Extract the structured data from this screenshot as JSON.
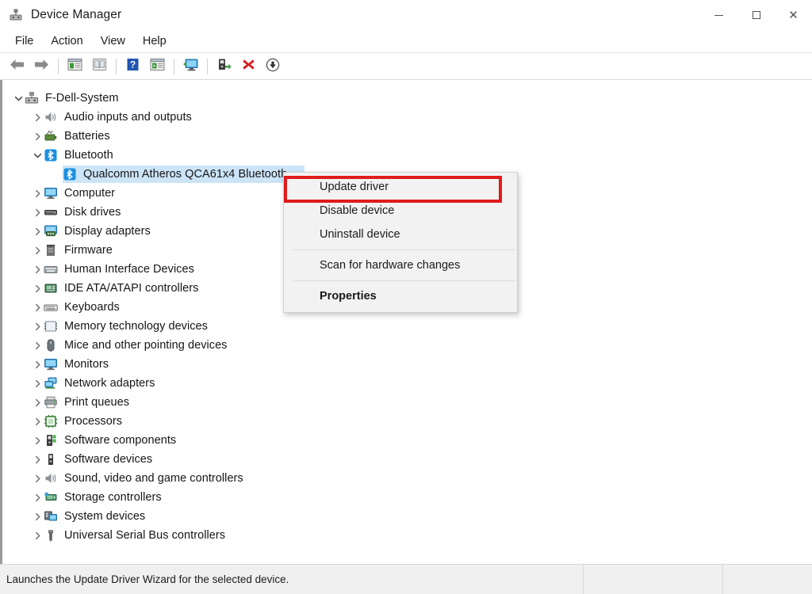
{
  "window": {
    "title": "Device Manager",
    "icon": "device-manager-icon",
    "controls": {
      "minimize": "minimize-icon",
      "maximize": "maximize-icon",
      "close": "close-icon"
    }
  },
  "menubar": {
    "items": [
      {
        "label": "File"
      },
      {
        "label": "Action"
      },
      {
        "label": "View"
      },
      {
        "label": "Help"
      }
    ]
  },
  "toolbar": {
    "buttons": [
      {
        "name": "back-arrow-icon",
        "icon": "arrow-left"
      },
      {
        "name": "forward-arrow-icon",
        "icon": "arrow-right"
      },
      {
        "name": "separator",
        "icon": "sep"
      },
      {
        "name": "properties-icon",
        "icon": "window-props"
      },
      {
        "name": "help-topics-icon",
        "icon": "book"
      },
      {
        "name": "separator",
        "icon": "sep"
      },
      {
        "name": "help-icon",
        "icon": "question"
      },
      {
        "name": "show-hidden-devices-icon",
        "icon": "window-play"
      },
      {
        "name": "separator",
        "icon": "sep"
      },
      {
        "name": "scan-hardware-changes-icon",
        "icon": "monitor-scan"
      },
      {
        "name": "separator",
        "icon": "sep"
      },
      {
        "name": "update-driver-icon",
        "icon": "driver-update"
      },
      {
        "name": "uninstall-device-icon",
        "icon": "red-x"
      },
      {
        "name": "disable-device-icon",
        "icon": "down-arrow-circle"
      }
    ]
  },
  "tree": {
    "nodes": [
      {
        "label": "F-Dell-System",
        "level": 0,
        "expanded": true,
        "icon": "computer-root-icon",
        "selected": false
      },
      {
        "label": "Audio inputs and outputs",
        "level": 1,
        "expanded": false,
        "icon": "speaker-icon",
        "selected": false
      },
      {
        "label": "Batteries",
        "level": 1,
        "expanded": false,
        "icon": "battery-icon",
        "selected": false
      },
      {
        "label": "Bluetooth",
        "level": 1,
        "expanded": true,
        "icon": "bluetooth-icon",
        "selected": false
      },
      {
        "label": "Qualcomm Atheros QCA61x4 Bluetooth",
        "level": 2,
        "expanded": null,
        "icon": "bluetooth-icon",
        "selected": true
      },
      {
        "label": "Computer",
        "level": 1,
        "expanded": false,
        "icon": "monitor-icon",
        "selected": false
      },
      {
        "label": "Disk drives",
        "level": 1,
        "expanded": false,
        "icon": "disk-icon",
        "selected": false
      },
      {
        "label": "Display adapters",
        "level": 1,
        "expanded": false,
        "icon": "display-adapter-icon",
        "selected": false
      },
      {
        "label": "Firmware",
        "level": 1,
        "expanded": false,
        "icon": "firmware-icon",
        "selected": false
      },
      {
        "label": "Human Interface Devices",
        "level": 1,
        "expanded": false,
        "icon": "hid-icon",
        "selected": false
      },
      {
        "label": "IDE ATA/ATAPI controllers",
        "level": 1,
        "expanded": false,
        "icon": "ide-controller-icon",
        "selected": false
      },
      {
        "label": "Keyboards",
        "level": 1,
        "expanded": false,
        "icon": "keyboard-icon",
        "selected": false
      },
      {
        "label": "Memory technology devices",
        "level": 1,
        "expanded": false,
        "icon": "memory-icon",
        "selected": false
      },
      {
        "label": "Mice and other pointing devices",
        "level": 1,
        "expanded": false,
        "icon": "mouse-icon",
        "selected": false
      },
      {
        "label": "Monitors",
        "level": 1,
        "expanded": false,
        "icon": "monitor-icon",
        "selected": false
      },
      {
        "label": "Network adapters",
        "level": 1,
        "expanded": false,
        "icon": "network-adapter-icon",
        "selected": false
      },
      {
        "label": "Print queues",
        "level": 1,
        "expanded": false,
        "icon": "printer-icon",
        "selected": false
      },
      {
        "label": "Processors",
        "level": 1,
        "expanded": false,
        "icon": "processor-icon",
        "selected": false
      },
      {
        "label": "Software components",
        "level": 1,
        "expanded": false,
        "icon": "software-component-icon",
        "selected": false
      },
      {
        "label": "Software devices",
        "level": 1,
        "expanded": false,
        "icon": "software-device-icon",
        "selected": false
      },
      {
        "label": "Sound, video and game controllers",
        "level": 1,
        "expanded": false,
        "icon": "sound-icon",
        "selected": false
      },
      {
        "label": "Storage controllers",
        "level": 1,
        "expanded": false,
        "icon": "storage-controller-icon",
        "selected": false
      },
      {
        "label": "System devices",
        "level": 1,
        "expanded": false,
        "icon": "system-device-icon",
        "selected": false
      },
      {
        "label": "Universal Serial Bus controllers",
        "level": 1,
        "expanded": false,
        "icon": "usb-icon",
        "selected": false
      }
    ]
  },
  "context_menu": {
    "items": [
      {
        "label": "Update driver",
        "bold": false,
        "highlighted": true
      },
      {
        "label": "Disable device",
        "bold": false,
        "highlighted": false
      },
      {
        "label": "Uninstall device",
        "bold": false,
        "highlighted": false
      },
      {
        "separator": true
      },
      {
        "label": "Scan for hardware changes",
        "bold": false,
        "highlighted": false
      },
      {
        "separator": true
      },
      {
        "label": "Properties",
        "bold": true,
        "highlighted": false
      }
    ]
  },
  "statusbar": {
    "text": "Launches the Update Driver Wizard for the selected device."
  },
  "colors": {
    "selection": "#cce4f7",
    "annotation": "#e01b1b",
    "bluetooth": "#1a8fe0",
    "accent_green": "#3a9a3a"
  }
}
